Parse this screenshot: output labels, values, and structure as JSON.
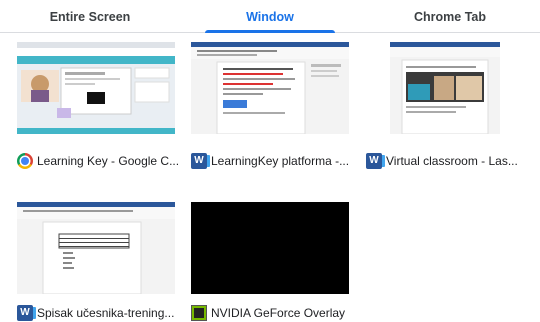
{
  "tabs": [
    {
      "label": "Entire Screen",
      "active": false
    },
    {
      "label": "Window",
      "active": true
    },
    {
      "label": "Chrome Tab",
      "active": false
    }
  ],
  "accent_color": "#1a73e8",
  "windows": [
    {
      "title": "Learning Key - Google C...",
      "app_icon": "chrome-icon"
    },
    {
      "title": "LearningKey platforma -...",
      "app_icon": "word-icon"
    },
    {
      "title": "Virtual classroom  -  Las...",
      "app_icon": "word-icon"
    },
    {
      "title": "Spisak učesnika-trening...",
      "app_icon": "word-icon"
    },
    {
      "title": "NVIDIA GeForce Overlay",
      "app_icon": "nvidia-icon"
    }
  ],
  "word_icon_letter": "W"
}
